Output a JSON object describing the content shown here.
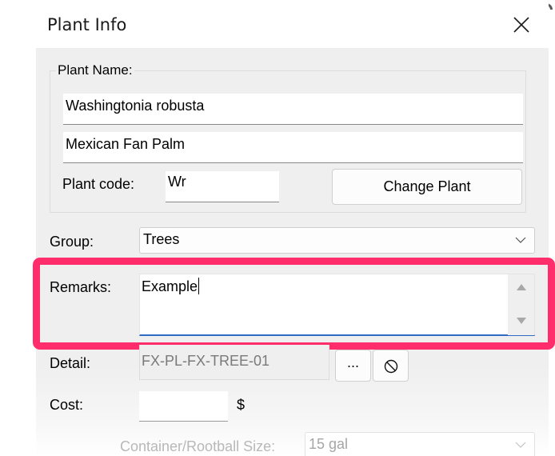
{
  "window": {
    "title": "Plant Info",
    "close_icon": "close-icon"
  },
  "plant_name": {
    "group_label": "Plant Name:",
    "botanical_name": "Washingtonia robusta",
    "common_name": "Mexican Fan Palm",
    "plant_code_label": "Plant code:",
    "plant_code": "Wr",
    "change_plant_label": "Change Plant"
  },
  "group": {
    "label": "Group:",
    "selected": "Trees",
    "dropdown_icon": "chevron-down-icon"
  },
  "remarks": {
    "label": "Remarks:",
    "value": "Example",
    "highlight_color": "#ff2d6b",
    "focus_color": "#2f6bc4"
  },
  "detail": {
    "label": "Detail:",
    "value": "FX-PL-FX-TREE-01",
    "browse_label": "...",
    "clear_icon": "prohibited-icon"
  },
  "cost": {
    "label": "Cost:",
    "value": "",
    "currency": "$"
  },
  "container": {
    "label": "Container/Rootball Size:",
    "selected": "15 gal"
  }
}
